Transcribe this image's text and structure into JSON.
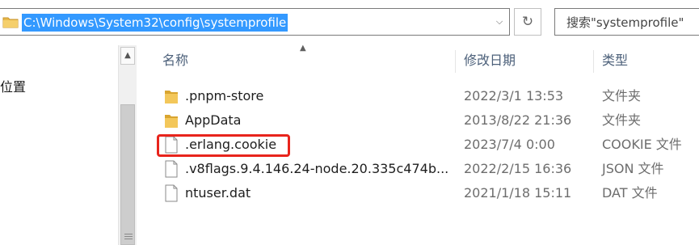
{
  "address": {
    "path": "C:\\Windows\\System32\\config\\systemprofile"
  },
  "search": {
    "placeholder": "搜索\"systemprofile\""
  },
  "nav": {
    "label": "位置"
  },
  "columns": {
    "name": "名称",
    "date": "修改日期",
    "type": "类型"
  },
  "files": [
    {
      "name": ".pnpm-store",
      "date": "2022/3/1 13:53",
      "type": "文件夹",
      "icon": "folder-icon"
    },
    {
      "name": "AppData",
      "date": "2013/8/22 21:36",
      "type": "文件夹",
      "icon": "folder-icon"
    },
    {
      "name": ".erlang.cookie",
      "date": "2023/7/4 0:00",
      "type": "COOKIE 文件",
      "icon": "file-icon"
    },
    {
      "name": ".v8flags.9.4.146.24-node.20.335c474b...",
      "date": "2022/2/15 16:36",
      "type": "JSON 文件",
      "icon": "file-icon"
    },
    {
      "name": "ntuser.dat",
      "date": "2021/1/18 15:11",
      "type": "DAT 文件",
      "icon": "file-icon"
    }
  ],
  "colors": {
    "selection": "#3399ff",
    "highlight_border": "#e8241c",
    "folder": "#e8b84a"
  }
}
